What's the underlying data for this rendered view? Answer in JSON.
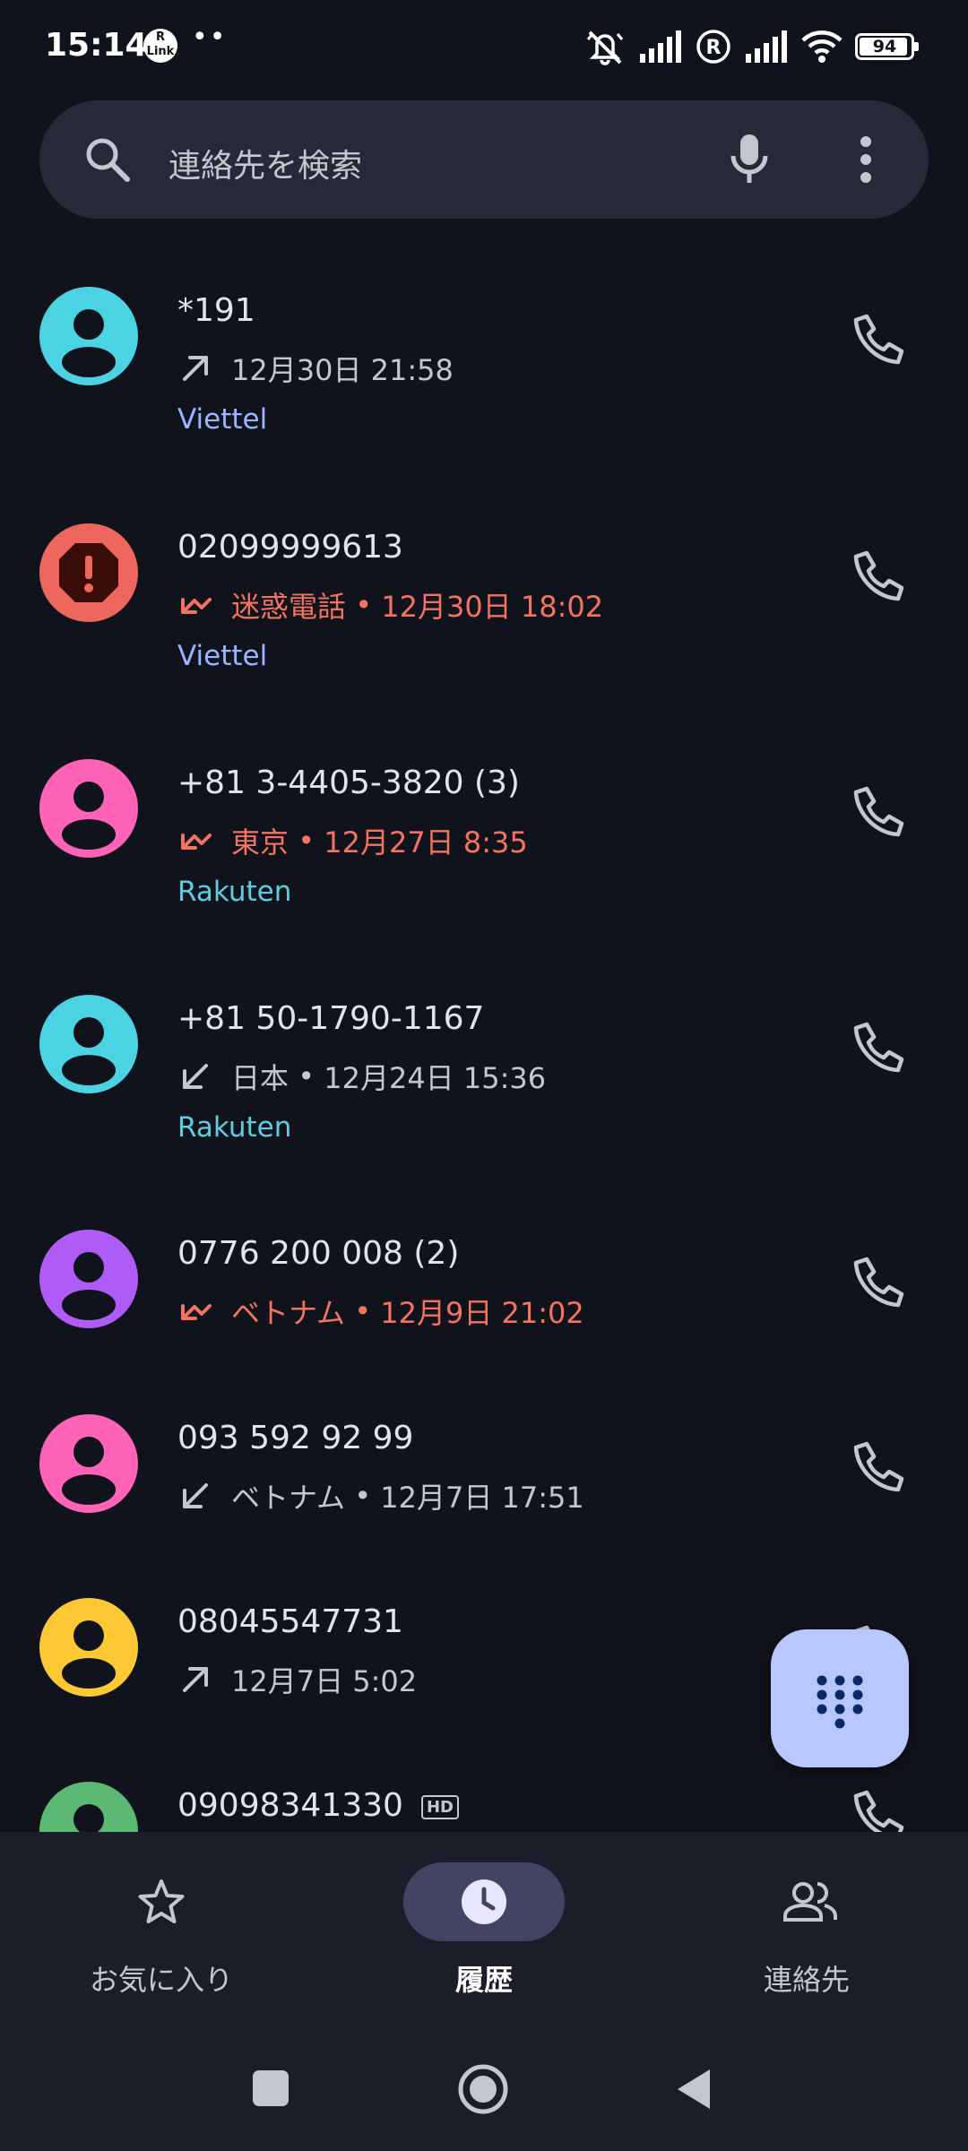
{
  "status_bar": {
    "time": "15:14",
    "rlink_label": "R\nLink",
    "dots": "••",
    "battery_level": "94",
    "battery_fraction": 0.94,
    "icons": [
      "mute-icon",
      "signal-icon",
      "roaming-icon",
      "signal-icon",
      "wifi-icon",
      "battery-icon"
    ]
  },
  "search": {
    "placeholder": "連絡先を検索"
  },
  "calls": [
    {
      "name": "*191",
      "direction": "outgoing",
      "missed": false,
      "location": "",
      "time": "12月30日 21:58",
      "sim": "Viettel",
      "sim_color": "#9bb4ff",
      "avatar_color": "#4cd3e3",
      "avatar_type": "person"
    },
    {
      "name": "02099999613",
      "direction": "missed",
      "missed": true,
      "location": "迷惑電話",
      "time": "12月30日 18:02",
      "sim": "Viettel",
      "sim_color": "#9bb4ff",
      "avatar_color": "#ee675c",
      "avatar_type": "spam"
    },
    {
      "name": "+81 3-4405-3820 (3)",
      "direction": "missed",
      "missed": true,
      "location": "東京",
      "time": "12月27日 8:35",
      "sim": "Rakuten",
      "sim_color": "#5dcde0",
      "avatar_color": "#ff63b8",
      "avatar_type": "person"
    },
    {
      "name": "+81 50-1790-1167",
      "direction": "incoming",
      "missed": false,
      "location": "日本",
      "time": "12月24日 15:36",
      "sim": "Rakuten",
      "sim_color": "#5dcde0",
      "avatar_color": "#4cd3e3",
      "avatar_type": "person"
    },
    {
      "name": "0776 200 008 (2)",
      "direction": "missed",
      "missed": true,
      "location": "ベトナム",
      "time": "12月9日 21:02",
      "sim": "",
      "sim_color": "",
      "avatar_color": "#af5cf7",
      "avatar_type": "person"
    },
    {
      "name": "093 592 92 99",
      "direction": "incoming",
      "missed": false,
      "location": "ベトナム",
      "time": "12月7日 17:51",
      "sim": "",
      "sim_color": "",
      "avatar_color": "#ff63b8",
      "avatar_type": "person"
    },
    {
      "name": "08045547731",
      "direction": "outgoing",
      "missed": false,
      "location": "",
      "time": "12月7日 5:02",
      "sim": "",
      "sim_color": "",
      "avatar_color": "#fcc934",
      "avatar_type": "person"
    },
    {
      "name": "09098341330",
      "hd": "HD",
      "direction": "",
      "missed": false,
      "location": "",
      "time": "",
      "sim": "",
      "sim_color": "",
      "avatar_color": "#5bb974",
      "avatar_type": "person"
    }
  ],
  "fab": {
    "icon": "dialpad-icon"
  },
  "bottom_nav": [
    {
      "label": "お気に入り",
      "icon": "star-icon",
      "active": false
    },
    {
      "label": "履歴",
      "icon": "clock-icon",
      "active": true
    },
    {
      "label": "連絡先",
      "icon": "people-icon",
      "active": false
    }
  ],
  "system_nav": {
    "icons": [
      "recents-icon",
      "home-icon",
      "back-icon"
    ]
  },
  "colors": {
    "background": "#11131c",
    "missed": "#f2735f",
    "fab": "#b9c7ff",
    "nav_active_pill": "#424464"
  }
}
